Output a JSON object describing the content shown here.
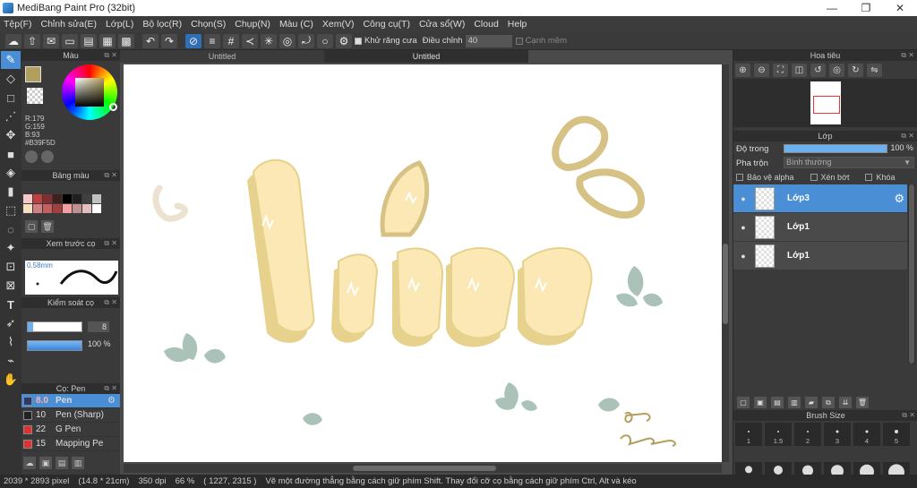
{
  "window": {
    "title": "MediBang Paint Pro (32bit)",
    "btn_min": "—",
    "btn_max": "❐",
    "btn_close": "✕"
  },
  "menu": [
    "Tệp(F)",
    "Chỉnh sửa(E)",
    "Lớp(L)",
    "Bộ lọc(R)",
    "Chọn(S)",
    "Chụp(N)",
    "Màu (C)",
    "Xem(V)",
    "Công cụ(T)",
    "Cửa sổ(W)",
    "Cloud",
    "Help"
  ],
  "options": {
    "antialias_label": "Khử răng cưa",
    "adjust_label": "Điều chỉnh",
    "adjust_value": "40",
    "edge_label": "Cạnh mềm"
  },
  "panels": {
    "color_title": "Màu",
    "palette_title": "Bảng màu",
    "brush_preview_title": "Xem trước cọ",
    "brush_control_title": "Kiểm soát cọ",
    "brush_title": "Cọ: Pen",
    "navigator_title": "Hoa tiêu",
    "layer_title": "Lớp",
    "brush_size_title": "Brush Size"
  },
  "color": {
    "r": "R:179",
    "g": "G:159",
    "b": "B:93",
    "hex": "#B39F5D",
    "fg": "#b39f5d",
    "bg": "#ffffff"
  },
  "palette_colors": [
    "#f5c9c9",
    "#c04040",
    "#803030",
    "#402020",
    "#000000",
    "#202020",
    "#404040",
    "#c0c0c0",
    "#f5e0c0",
    "#d08080",
    "#c06060",
    "#a04040",
    "#f0a0a0",
    "#c09090",
    "#e0c0c0",
    "#ffffff"
  ],
  "brush_preview": {
    "size_label": "0.58mm"
  },
  "brush_control": {
    "size_value": "8",
    "opacity_value": "100 %"
  },
  "brush_list": [
    {
      "size": "8.0",
      "name": "Pen",
      "color": "#2a3a6a",
      "selected": true
    },
    {
      "size": "10",
      "name": "Pen (Sharp)",
      "color": "#222222",
      "selected": false
    },
    {
      "size": "22",
      "name": "G Pen",
      "color": "#e03030",
      "selected": false
    },
    {
      "size": "15",
      "name": "Mapping Pen",
      "color": "#e03030",
      "selected": false
    }
  ],
  "tabs": [
    "Untitled",
    "Untitled"
  ],
  "layers": {
    "opacity_label": "Độ trong",
    "opacity_value": "100 %",
    "blend_label": "Pha trộn",
    "blend_value": "Bình thường",
    "protect_alpha": "Bảo vệ alpha",
    "clipping": "Xén bớt",
    "lock": "Khóa",
    "items": [
      {
        "name": "Lớp3",
        "selected": true
      },
      {
        "name": "Lớp1",
        "selected": false
      },
      {
        "name": "Lớp1",
        "selected": false
      }
    ]
  },
  "brush_sizes": [
    "1",
    "1.5",
    "2",
    "3",
    "4",
    "5"
  ],
  "status": {
    "size": "2039 * 2893 pixel",
    "physical": "(14.8 * 21cm)",
    "dpi": "350 dpi",
    "zoom": "66 %",
    "coords": "( 1227, 2315 )",
    "hint": "Vẽ một đường thẳng bằng cách giữ phím Shift. Thay đổi cỡ cọ bằng cách giữ phím Ctrl, Alt và kéo"
  },
  "artwork": {
    "fill_color": "#fbe8b4",
    "shadow_color": "#e6d28c",
    "outline_color": "#d7c285",
    "leaf_color": "#8eae9f",
    "signature_color": "#b39f5d"
  }
}
